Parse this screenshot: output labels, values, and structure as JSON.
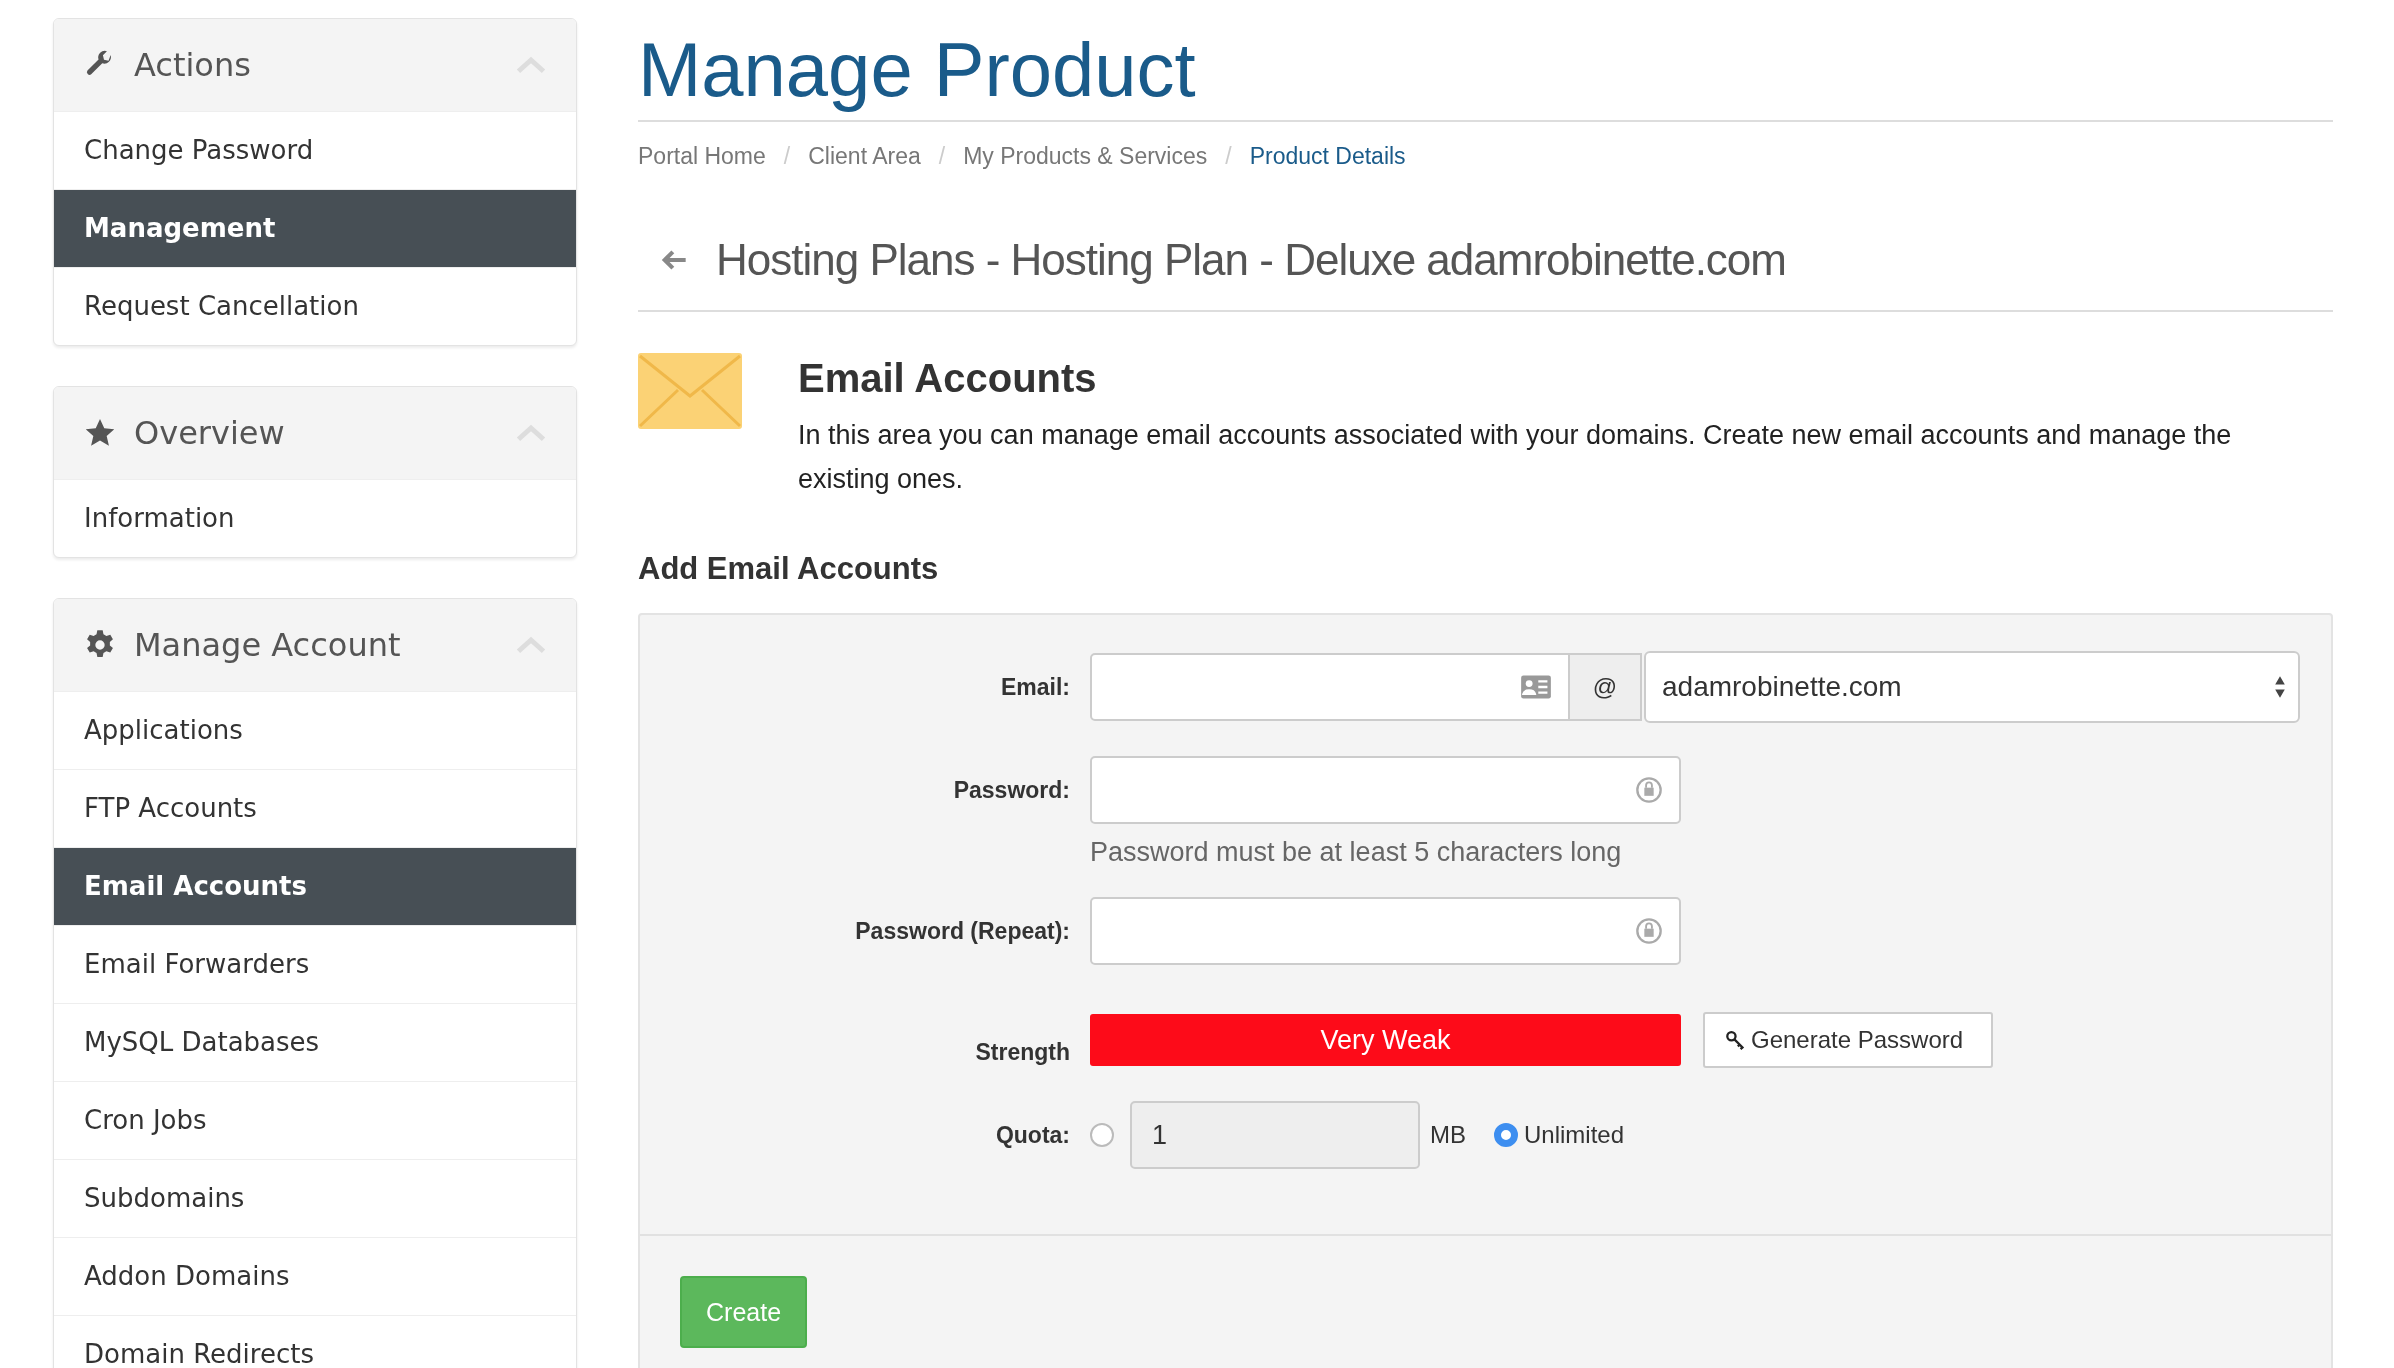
{
  "sidebar": {
    "panels": [
      {
        "title": "Actions",
        "expanded": true,
        "items": [
          {
            "label": "Change Password",
            "selected": false
          },
          {
            "label": "Management",
            "selected": true
          },
          {
            "label": "Request Cancellation",
            "selected": false
          }
        ]
      },
      {
        "title": "Overview",
        "expanded": true,
        "items": [
          {
            "label": "Information",
            "selected": false
          }
        ]
      },
      {
        "title": "Manage Account",
        "expanded": true,
        "items": [
          {
            "label": "Applications",
            "selected": false
          },
          {
            "label": "FTP Accounts",
            "selected": false
          },
          {
            "label": "Email Accounts",
            "selected": true
          },
          {
            "label": "Email Forwarders",
            "selected": false
          },
          {
            "label": "MySQL Databases",
            "selected": false
          },
          {
            "label": "Cron Jobs",
            "selected": false
          },
          {
            "label": "Subdomains",
            "selected": false
          },
          {
            "label": "Addon Domains",
            "selected": false
          },
          {
            "label": "Domain Redirects",
            "selected": false
          }
        ]
      }
    ]
  },
  "page_title": "Manage Product",
  "breadcrumb": [
    {
      "label": "Portal Home",
      "current": false
    },
    {
      "separator": "/",
      "label": "Client Area",
      "current": false
    },
    {
      "separator": "/",
      "label": "My Products & Services",
      "current": false
    },
    {
      "separator": "/",
      "label": "Product Details",
      "current": true
    }
  ],
  "product_heading": "Hosting Plans - Hosting Plan - Deluxe adamrobinette.com",
  "section": {
    "title": "Email Accounts",
    "description": "In this area you can manage email accounts associated with your domains. Create new email accounts and manage the existing ones."
  },
  "form": {
    "heading": "Add Email Accounts",
    "email": {
      "label": "Email:",
      "at": "@",
      "domain": "adamrobinette.com"
    },
    "password": {
      "label": "Password:",
      "hint": "Password must be at least 5 characters long"
    },
    "password_repeat": {
      "label": "Password (Repeat):"
    },
    "strength": {
      "label": "Strength",
      "value": "Very Weak"
    },
    "generate_button": "Generate Password",
    "quota": {
      "label": "Quota:",
      "amount": {
        "selected": false,
        "value": "1",
        "unit": "MB"
      },
      "unlimited": {
        "selected": true,
        "label": "Unlimited"
      }
    },
    "create_button": "Create"
  }
}
